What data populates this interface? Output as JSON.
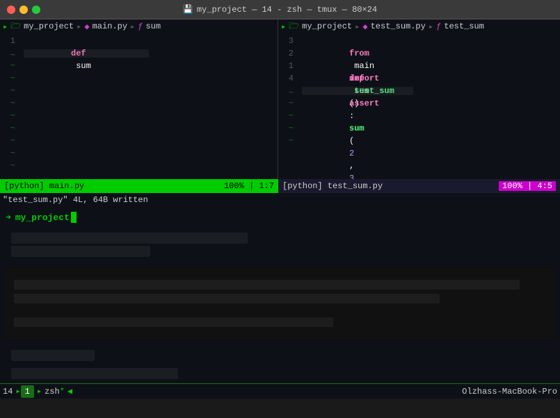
{
  "titlebar": {
    "title": "my_project — 14 - zsh — tmux — 80×24",
    "disk_icon": "💾"
  },
  "left_pane": {
    "header": "my_project  main.py   ƒ  sum",
    "lines": [
      {
        "num": "1",
        "content": "def sum",
        "type": "code"
      },
      {
        "num": "~",
        "type": "tilde"
      },
      {
        "num": "~",
        "type": "tilde"
      },
      {
        "num": "~",
        "type": "tilde"
      },
      {
        "num": "~",
        "type": "tilde"
      },
      {
        "num": "~",
        "type": "tilde"
      },
      {
        "num": "~",
        "type": "tilde"
      },
      {
        "num": "~",
        "type": "tilde"
      },
      {
        "num": "~",
        "type": "tilde"
      },
      {
        "num": "~",
        "type": "tilde"
      }
    ],
    "statusbar": {
      "mode": "[python] main.py",
      "position": "100% | 1:7"
    }
  },
  "right_pane": {
    "header": "my_project  test_sum.py   ƒ  test_sum",
    "lines": [
      {
        "num": "3",
        "type": "from_import"
      },
      {
        "num": "2",
        "type": "empty"
      },
      {
        "num": "1",
        "type": "def_test_sum"
      },
      {
        "num": "4",
        "type": "assert_line"
      }
    ],
    "statusbar": {
      "mode": "[python] test_sum.py",
      "position": "100% | 4:5"
    }
  },
  "written_line": "\"test_sum.py\" 4L, 64B written",
  "terminal": {
    "prompt_arrow": "➜",
    "directory": "my_project",
    "cursor": true
  },
  "tmux_bar": {
    "index": "14",
    "tab_num": "1",
    "shell": "zsh",
    "star": "*",
    "hostname": "Olzhass-MacBook-Pro"
  }
}
